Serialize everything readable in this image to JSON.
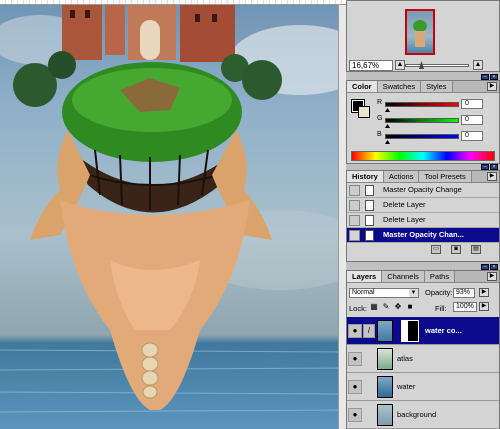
{
  "navigator": {
    "zoom": "16,67%"
  },
  "color_panel": {
    "tabs": [
      "Color",
      "Swatches",
      "Styles"
    ],
    "channels": [
      {
        "label": "R",
        "value": "0",
        "color": "#ff0000"
      },
      {
        "label": "G",
        "value": "0",
        "color": "#00ff00"
      },
      {
        "label": "B",
        "value": "0",
        "color": "#0000ff"
      }
    ],
    "foreground": "#000000",
    "background": "#e9e3c9"
  },
  "history_panel": {
    "tabs": [
      "History",
      "Actions",
      "Tool Presets"
    ],
    "items": [
      {
        "label": "Master Opacity Change",
        "selected": false
      },
      {
        "label": "Delete Layer",
        "selected": false
      },
      {
        "label": "Delete Layer",
        "selected": false
      },
      {
        "label": "Master Opacity Chan...",
        "selected": true
      }
    ]
  },
  "layers_panel": {
    "tabs": [
      "Layers",
      "Channels",
      "Paths"
    ],
    "blend_mode": "Normal",
    "opacity_label": "Opacity:",
    "opacity": "93%",
    "lock_label": "Lock:",
    "fill_label": "Fill:",
    "fill": "100%",
    "layers": [
      {
        "name": "water co...",
        "selected": true
      },
      {
        "name": "atlas",
        "selected": false
      },
      {
        "name": "water",
        "selected": false
      },
      {
        "name": "background",
        "selected": false
      }
    ]
  }
}
